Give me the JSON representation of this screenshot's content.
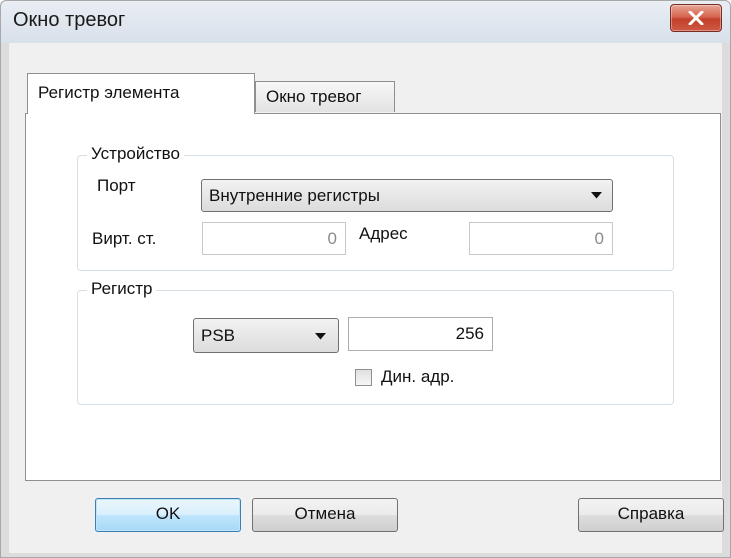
{
  "window": {
    "title": "Окно тревог"
  },
  "tabs": [
    {
      "label": "Регистр элемента",
      "active": true
    },
    {
      "label": "Окно тревог",
      "active": false
    }
  ],
  "device_group": {
    "title": "Устройство",
    "port_label": "Порт",
    "port_value": "Внутренние регистры",
    "virt_label": "Вирт. ст.",
    "virt_value": "0",
    "address_label": "Адрес",
    "address_value": "0"
  },
  "register_group": {
    "title": "Регистр",
    "type_value": "PSB",
    "number_value": "256",
    "dynamic_label": "Дин. адр.",
    "dynamic_checked": false
  },
  "buttons": {
    "ok": "OK",
    "cancel": "Отмена",
    "help": "Справка"
  },
  "colors": {
    "close_button": "#c9452f",
    "default_button_border": "#3c7fb1",
    "group_border": "#d5dfe5"
  }
}
